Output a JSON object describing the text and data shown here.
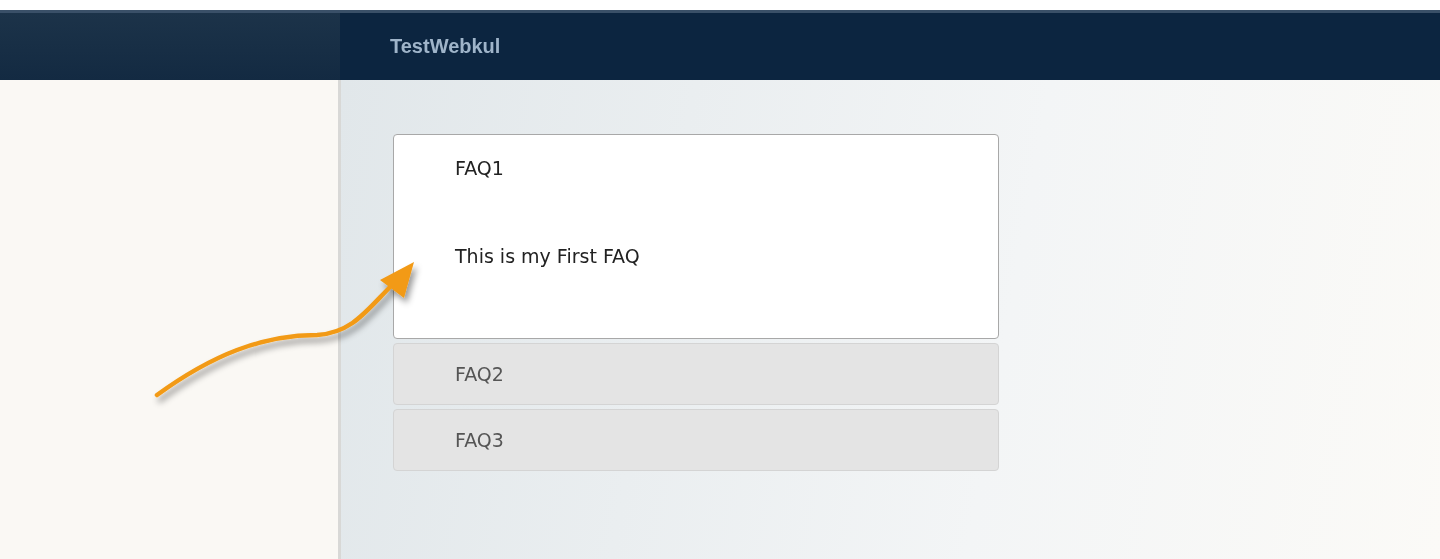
{
  "header": {
    "title": "TestWebkul"
  },
  "faqs": [
    {
      "title": "FAQ1",
      "answer": "This is my First FAQ",
      "expanded": true
    },
    {
      "title": "FAQ2",
      "expanded": false
    },
    {
      "title": "FAQ3",
      "expanded": false
    }
  ]
}
